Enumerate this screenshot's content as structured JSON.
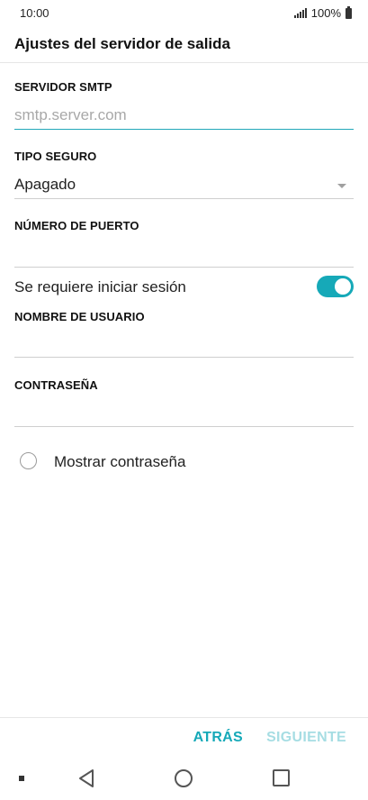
{
  "status_bar": {
    "time": "10:00",
    "battery": "100%",
    "signal_icon": "signal-icon",
    "battery_icon": "battery-icon"
  },
  "header": {
    "title": "Ajustes del servidor de salida"
  },
  "form": {
    "smtp_label": "SERVIDOR SMTP",
    "smtp_placeholder": "smtp.server.com",
    "smtp_value": "",
    "security_label": "TIPO SEGURO",
    "security_value": "Apagado",
    "port_label": "NÚMERO DE PUERTO",
    "port_value": "",
    "login_required_label": "Se requiere iniciar sesión",
    "login_required": true,
    "username_label": "NOMBRE DE USUARIO",
    "username_value": "",
    "password_label": "CONTRASEÑA",
    "password_value": "",
    "show_password_label": "Mostrar contraseña",
    "show_password": false
  },
  "actions": {
    "back_label": "ATRÁS",
    "next_label": "SIGUIENTE"
  },
  "colors": {
    "accent": "#16a9b8",
    "accent_disabled": "#a6dde3"
  },
  "nav": {
    "back_icon": "nav-back-icon",
    "home_icon": "nav-home-icon",
    "recents_icon": "nav-recents-icon"
  }
}
